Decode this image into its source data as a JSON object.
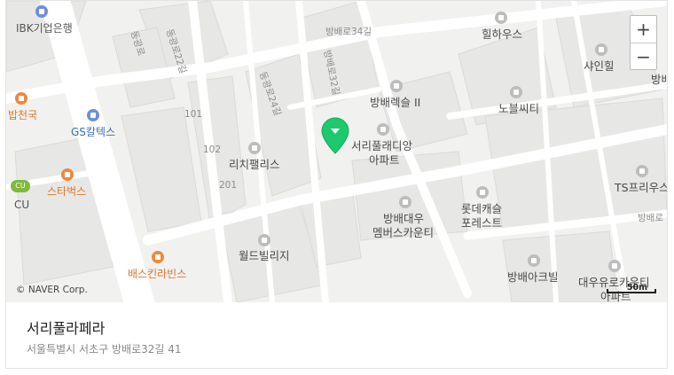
{
  "labels": [
    {
      "id": "ibk",
      "text": "IBK기업은행"
    },
    {
      "id": "hillhouse",
      "text": "힐하우스"
    },
    {
      "id": "shinehill",
      "text": "샤인힐"
    },
    {
      "id": "bangbae_right",
      "text": "방배"
    },
    {
      "id": "bangbaeleksle",
      "text": "방배렉슬 II"
    },
    {
      "id": "noblecity",
      "text": "노블씨티"
    },
    {
      "id": "seoripuradian1",
      "text": "서리풀래디앙"
    },
    {
      "id": "seoripuradian2",
      "text": "아파트"
    },
    {
      "id": "richpalace",
      "text": "리치팰리스"
    },
    {
      "id": "n101",
      "text": "101"
    },
    {
      "id": "n102",
      "text": "102"
    },
    {
      "id": "n201",
      "text": "201"
    },
    {
      "id": "tsfreus",
      "text": "TS프리우스"
    },
    {
      "id": "lottecastle1",
      "text": "롯데캐슬"
    },
    {
      "id": "lottecastle2",
      "text": "포레스트"
    },
    {
      "id": "bangbaedaewoo1",
      "text": "방배대우"
    },
    {
      "id": "bangbaedaewoo2",
      "text": "멤버스카운티"
    },
    {
      "id": "worldvillage",
      "text": "월드빌리지"
    },
    {
      "id": "bangbaeacre",
      "text": "방배아크빌"
    },
    {
      "id": "daewoo_county1",
      "text": "대우유로카운티"
    },
    {
      "id": "daewoo_county2",
      "text": "아파트"
    },
    {
      "id": "bapcheonguk",
      "text": "밥천국"
    },
    {
      "id": "gscaltex",
      "text": "GS칼텍스"
    },
    {
      "id": "cu_logo",
      "text": "CU"
    },
    {
      "id": "cu",
      "text": "CU"
    },
    {
      "id": "starbucks",
      "text": "스타벅스"
    },
    {
      "id": "baskin",
      "text": "배스킨라빈스"
    }
  ],
  "roads": {
    "r34": "방배로34길",
    "r32": "방배로32길",
    "r24": "동광로24길",
    "r22": "동광로22길",
    "r_left": "동광로",
    "r_right": "방배로"
  },
  "zoom": {
    "in": "+",
    "out": "−"
  },
  "copyright": "© NAVER Corp.",
  "scale": "50m",
  "place": {
    "name": "서리풀라페라",
    "address": "서울특별시 서초구 방배로32길 41"
  },
  "colors": {
    "marker": "#1ec96d",
    "poi_orange": "#f0883c",
    "poi_gray": "#bdbdbd",
    "poi_blue": "#6d8fd6"
  }
}
